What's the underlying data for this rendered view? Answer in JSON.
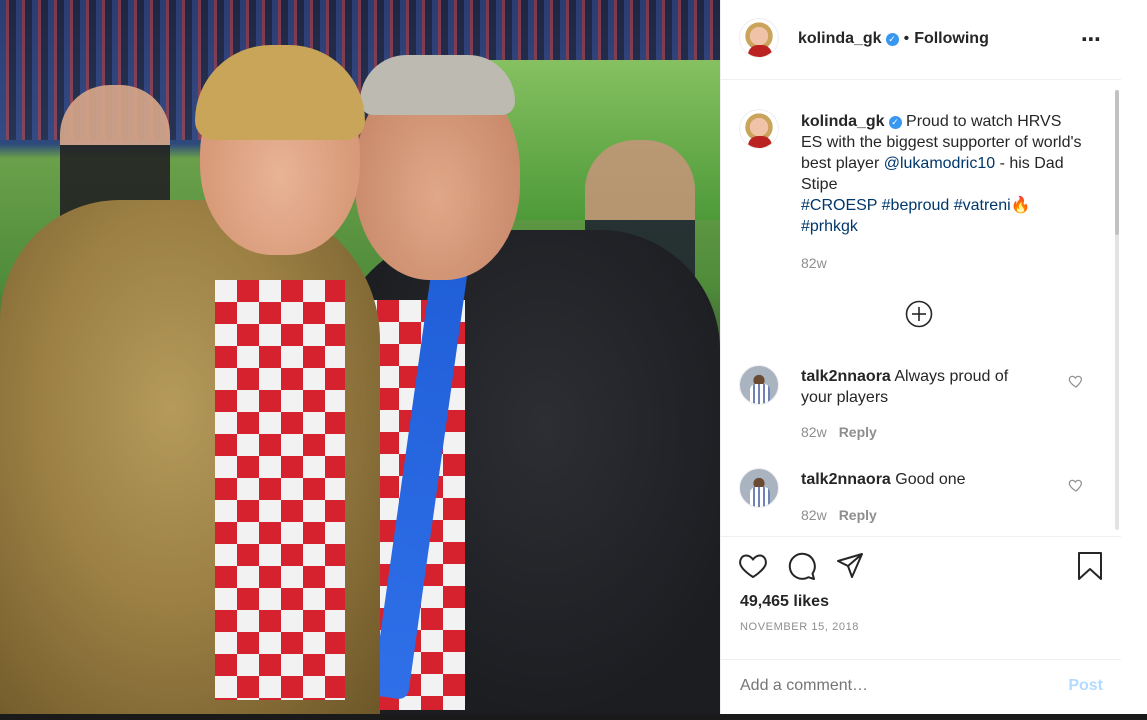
{
  "post": {
    "username": "kolinda_gk",
    "separator": "•",
    "follow_state": "Following",
    "more_icon": "⋯",
    "verified_icon": "✓"
  },
  "caption": {
    "username": "kolinda_gk",
    "text_before": " Proud to watch HRVS ES with the biggest supporter of world's best player ",
    "mention": "@lukamodric10",
    "text_after": " - his Dad Stipe",
    "hashtags": [
      "#CROESP",
      "#beproud",
      "#vatreni🔥",
      "#prhkgk"
    ],
    "age": "82w"
  },
  "comments": [
    {
      "username": "talk2nnaora",
      "text": "Always proud of your players",
      "age": "82w",
      "reply": "Reply"
    },
    {
      "username": "talk2nnaora",
      "text": "Good one",
      "age": "82w",
      "reply": "Reply"
    }
  ],
  "icons": {
    "like": "heart-icon",
    "comment": "comment-icon",
    "share": "share-icon",
    "save": "bookmark-icon",
    "load_more": "plus-circle-icon"
  },
  "likes": "49,465 likes",
  "date": "NOVEMBER 15, 2018",
  "add_comment": {
    "placeholder": "Add a comment…",
    "post_label": "Post"
  },
  "colors": {
    "link": "#00376b",
    "verified": "#3897f0",
    "post_disabled": "#b3dbff"
  }
}
